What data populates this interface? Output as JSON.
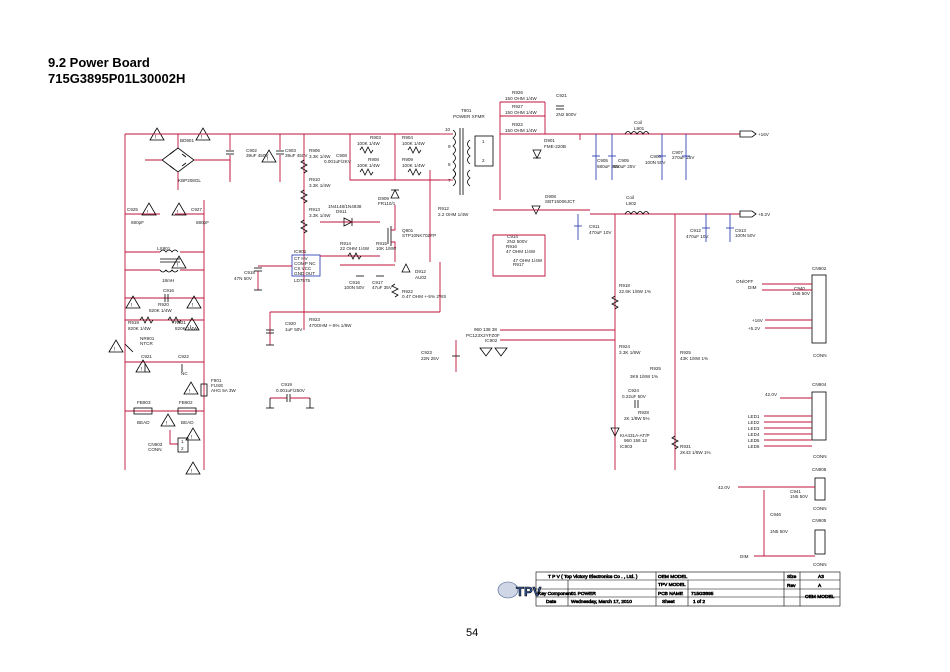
{
  "heading": {
    "title": "9.2 Power Board",
    "subtitle": "715G3895P01L30002H"
  },
  "page_number": "54",
  "components": {
    "bd901": "BD901",
    "bd901_val": "KBP208GL",
    "c902": "C902",
    "c902_val": "39uF 450V",
    "c903": "C903",
    "c903_val": "39uF 450V",
    "r906": "R906",
    "r906_val": "3.3K 1/4W",
    "r903": "R903",
    "r903_val": "100K 1/4W",
    "r904": "R904",
    "r904_val": "100K 1/4W",
    "r908": "R908",
    "r908_val": "100K 1/4W",
    "r909": "R909",
    "r909_val": "100K 1/4W",
    "c908": "C908",
    "c908_val": "0.001uF/2KV",
    "r910": "R910",
    "r910_val": "3.3K 1/4W",
    "r913": "R913",
    "r913_val": "3.3K 1/4W",
    "d911": "1N4148/1N4938",
    "d911_ref": "D911",
    "d909": "D909",
    "d909_val": "FR110/1",
    "t901": "T901",
    "t901_val": "POWER XFMR",
    "r926": "R926",
    "r926_val": "150 OHM 1/4W",
    "r927": "R927",
    "r927_val": "150 OHM 1/4W",
    "r922a": "R922",
    "r922a_val": "150 OHM 1/4W",
    "c921": "C921",
    "c921_val": "2N2 500V",
    "d901": "D901",
    "d901_val": "FME-220B",
    "l901": "Coil",
    "l901_ref": "L901",
    "c905a": "C905",
    "c905a_val": "680uF 25V",
    "c905b": "C905",
    "c905b_val": "680uF 25V",
    "c906": "C906",
    "c906_val": "100N 50V",
    "c907": "C907",
    "c907_val": "270uF 25V",
    "out_16v": "+16V",
    "d908": "D908",
    "d908_val": "SBT15006JCT",
    "c914": "C914",
    "c914_val": "2N2 500V",
    "r916": "R916",
    "r916_val": "47 OHM 1/4W",
    "r917": "R917",
    "r917_val": "47 OHM 1/4W",
    "c911": "C911",
    "c911_val": "470uF 10V",
    "l902": "Coil",
    "l902_ref": "L902",
    "c912": "C912",
    "c912_val": "470uF 10V",
    "c913": "C913",
    "c913_val": "100N 50V",
    "out_52v": "+5.2V",
    "q901": "Q901",
    "q901_val": "STP10NK70ZFP",
    "r912": "R912",
    "r912_val": "2.2 OHM 1/4W",
    "r914": "R914",
    "r914_val": "22 OHM 1/4W",
    "r915": "R915",
    "r915_val": "10K 1/8W",
    "c916": "C916",
    "c916_val": "100N 50V",
    "c917": "C917",
    "c917_val": "47uF 35V",
    "d912": "D912",
    "d912_val": "AU02",
    "r922": "R922",
    "r922_val": "0.47 OHM +-5% 2WS",
    "ic901": "IC901",
    "ic901_val": "LD7575",
    "ic901_pins": [
      "CT   HV",
      "COMP NC",
      "CS   VCC",
      "GND OUT"
    ],
    "c918": "C918",
    "c918_val": "47N 50V",
    "c920": "C920",
    "c920_val": "1uF 50V",
    "r923": "R923",
    "r923_val": "470OHM +-5% 1/8W",
    "c925": "C925",
    "c925_val": "680pF",
    "c927": "C927",
    "c927_val": "680pF",
    "lx901": "LX901",
    "lx901_val": "18mH",
    "c916b": "C916",
    "r920": "R920",
    "r920_val": "820K 1/4W",
    "r919": "R919",
    "r919_val": "820K 1/4W",
    "r921": "R921",
    "r921_val": "820K 1/4W",
    "nr901": "NR901",
    "nr901_val": "NTCR",
    "c921b": "C921",
    "c922": "C922",
    "c922_val": "NC",
    "f901": "F901",
    "f901_val": "FUSE",
    "f901_val2": "AHG 5A 3W",
    "c919": "C919",
    "c919_val": "0.001uF/250V",
    "fb903": "FB903",
    "fb903_val": "BEAD",
    "fb902": "FB902",
    "fb902_val": "BEAD",
    "cn903": "CN903",
    "cn903_val": "CONN",
    "ic902": "IC902",
    "ic902_val": "PC123X2YFZ0F",
    "ic902_val2": "960 138 38",
    "c923": "C923",
    "c923_val": "22N 25V",
    "r918": "R918",
    "r918_val": "22.6K 1/8W 1%",
    "r924": "R924",
    "r924_val": "3.3K 1/8W",
    "r925": "R925",
    "r925_val": "3K9 1/8W 1%",
    "c924": "C924",
    "c924_val": "0.22uF 50V",
    "r928": "R928",
    "r928_val": "2K 1/8W 5%",
    "ic903": "IC903",
    "ic903_val": "KIA431A-AT/P",
    "ic903_val2": "960 156 12",
    "r925b": "R925",
    "r925b_val": "43K 1/8W 1%",
    "r931": "R931",
    "r931_val": "2K43 1/8W 1%",
    "cn902": "CN902",
    "cn902_conn": "CONN",
    "cn902_in1": "ON/OFF",
    "cn902_in2": "DIM",
    "cn902_pwr1": "+16V",
    "cn902_pwr2": "+5.2V",
    "c940": "C940",
    "c940_val": "1N5 50V",
    "cn904": "CN904",
    "cn904_conn": "CONN",
    "cn904_in": "42.0V",
    "leds": [
      "LED1",
      "LED2",
      "LED3",
      "LED4",
      "LED5",
      "LED6"
    ],
    "cn908": "CN908",
    "cn908_conn": "CONN",
    "cn908_in": "42.0V",
    "c941": "C941",
    "c941_val": "1N5 50V",
    "c946": "C946",
    "c946_val": "1N5 50V",
    "cn905": "CN905",
    "cn905_conn": "CONN",
    "cn905_in": "DIM"
  },
  "title_block": {
    "company": "T P V  ( Top  Victory  Electronics  Co . , Ltd. )",
    "oem_model_label": "OEM MODEL",
    "size_label": "Size",
    "size_value": "A3",
    "tpv_model_label": "TPV MODEL",
    "rev_label": "Rev",
    "rev_value": "A",
    "key_component_label": "Key Component",
    "key_component_value": "01 POWER",
    "pcb_name_label": "PCB NAME",
    "pcb_name_value": "715G3895",
    "oem_model_value": "OEM MODEL",
    "date_label": "Date",
    "date_value": "Wednesday, March 17, 2010",
    "sheet_label": "Sheet",
    "sheet_value": "1   of   2",
    "logo_text": "TPV"
  }
}
